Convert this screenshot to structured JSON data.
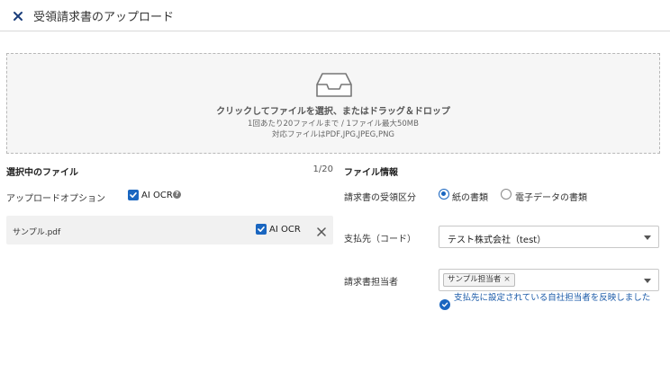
{
  "header": {
    "title": "受領請求書のアップロード",
    "close_icon": "close-icon"
  },
  "dropzone": {
    "icon": "inbox-tray-icon",
    "main_text": "クリックしてファイルを選択、またはドラッグ＆ドロップ",
    "limit_text": "1回あたり20ファイルまで / 1ファイル最大50MB",
    "formats_text": "対応ファイルはPDF,JPG,JPEG,PNG"
  },
  "selected_files": {
    "title": "選択中のファイル",
    "count": "1/20",
    "upload_option_label": "アップロードオプション",
    "ai_ocr_label": "AI OCR",
    "ai_ocr_checked": true,
    "files": [
      {
        "name": "サンプル.pdf",
        "ai_ocr_label": "AI OCR",
        "ai_ocr_checked": true
      }
    ]
  },
  "file_info": {
    "title": "ファイル情報",
    "receipt_type": {
      "label": "請求書の受領区分",
      "options": [
        "紙の書類",
        "電子データの書類"
      ],
      "selected": "紙の書類"
    },
    "payee": {
      "label": "支払先（コード）",
      "value": "テスト株式会社（test）"
    },
    "assignee": {
      "label": "請求書担当者",
      "tags": [
        "サンプル担当者"
      ],
      "tag_remove": "×",
      "note": "支払先に設定されている自社担当者を反映しました"
    }
  },
  "colors": {
    "accent": "#1a66c0",
    "note_text": "#1a5aa8",
    "dropzone_bg": "#f6f6f6",
    "file_row_bg": "#f1f1f1"
  }
}
